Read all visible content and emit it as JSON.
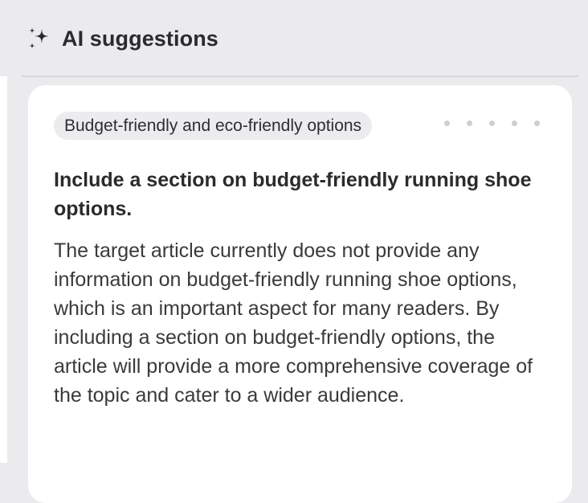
{
  "panel": {
    "title": "AI suggestions",
    "icon": "sparkles-icon"
  },
  "suggestion": {
    "tag": "Budget-friendly and eco-friendly options",
    "heading": "Include a section on budget-friendly running shoe options.",
    "body": "The target article currently does not provide any information on budget-friendly running shoe options, which is an important aspect for many readers. By including a section on budget-friendly options, the article will provide a more comprehensive coverage of the topic and cater to a wider audience.",
    "pagination_dot_count": 5
  },
  "colors": {
    "panel_background": "#ebebee",
    "card_background": "#ffffff",
    "tag_background": "#ececef",
    "text_primary": "#2b2b2e",
    "dot": "#cfcfd3"
  }
}
